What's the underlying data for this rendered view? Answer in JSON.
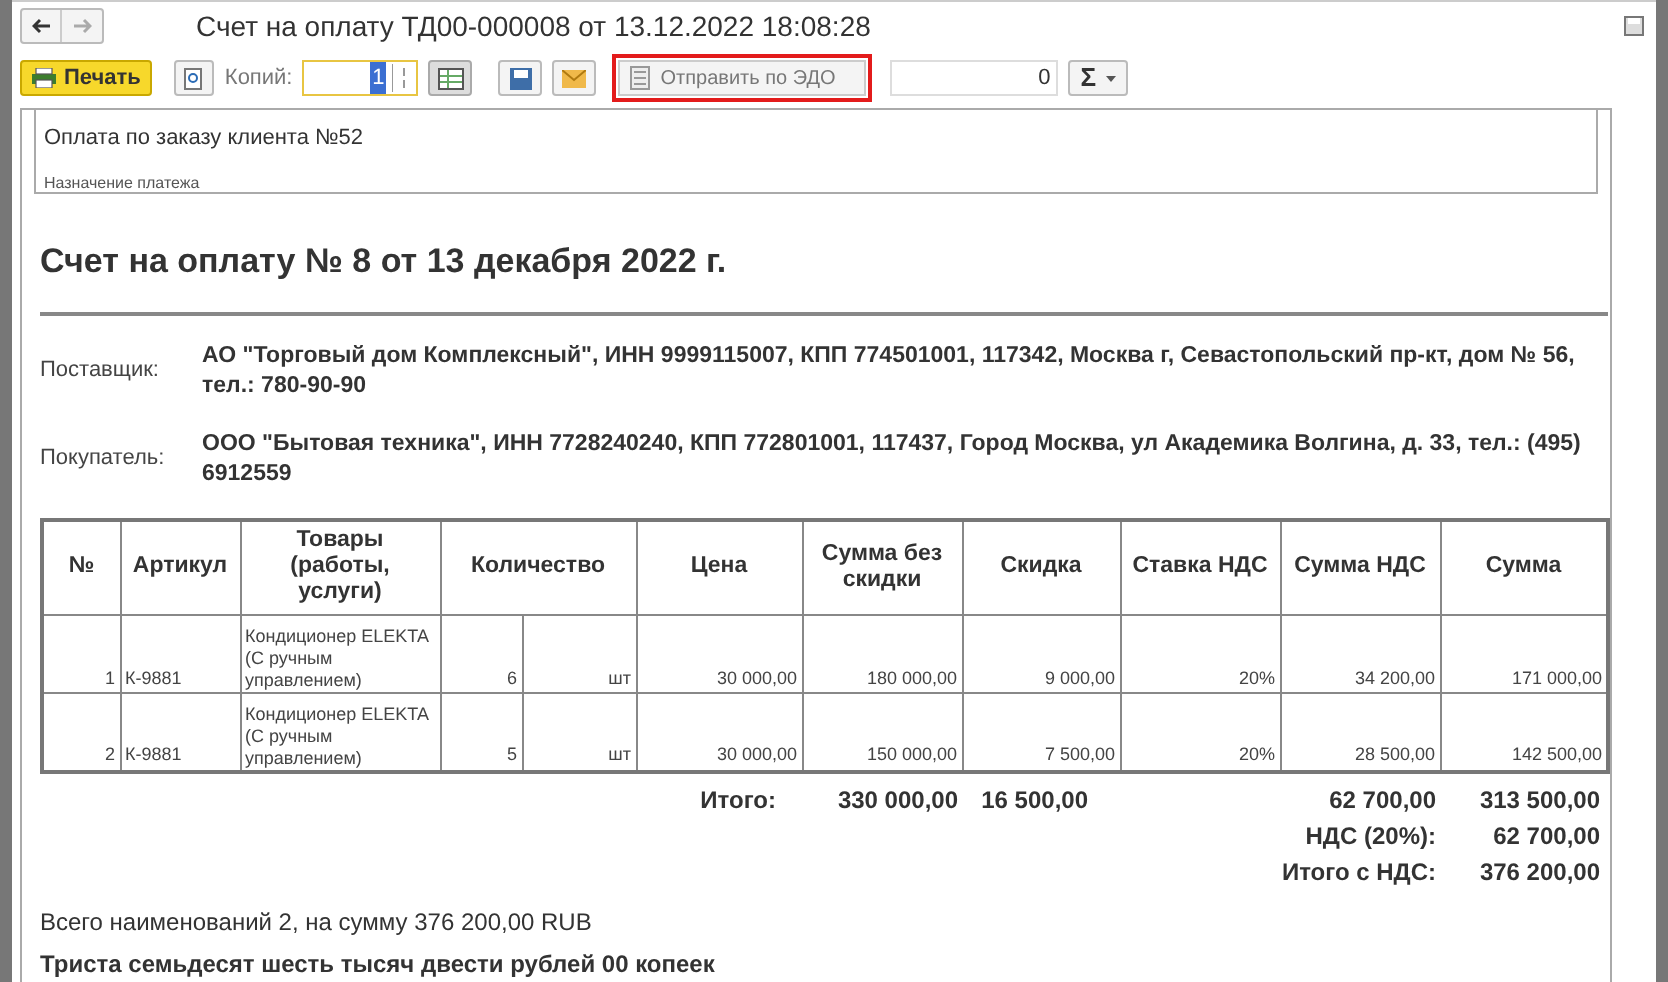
{
  "window": {
    "title": "Счет на оплату ТД00-000008 от 13.12.2022 18:08:28"
  },
  "toolbar": {
    "print": "Печать",
    "copies_label": "Копий:",
    "copies_value": "1",
    "send": "Отправить по ЭДО",
    "counter": "0",
    "sum_symbol": "Σ"
  },
  "note": {
    "value": "Оплата по заказу клиента №52",
    "label": "Назначение платежа"
  },
  "document": {
    "title": "Счет на оплату № 8 от 13 декабря 2022 г.",
    "parties": [
      {
        "label": "Поставщик:",
        "value": "АО \"Торговый дом Комплексный\", ИНН 9999115007, КПП 774501001, 117342, Москва г, Севастопольский пр-кт, дом № 56, тел.: 780-90-90"
      },
      {
        "label": "Покупатель:",
        "value": "ООО \"Бытовая техника\", ИНН 7728240240, КПП 772801001, 117437, Город Москва, ул Академика Волгина, д. 33, тел.: (495) 6912559"
      }
    ],
    "table": {
      "columns": [
        "№",
        "Артикул",
        "Товары (работы, услуги)",
        "Количество",
        "Цена",
        "Сумма без скидки",
        "Скидка",
        "Ставка НДС",
        "Сумма НДС",
        "Сумма"
      ],
      "rows": [
        {
          "num": "1",
          "article": "К-9881",
          "goods": "Кондиционер ELEKTA (С ручным управлением)",
          "qty": "6",
          "unit": "шт",
          "price": "30 000,00",
          "sum_no_discount": "180 000,00",
          "discount": "9 000,00",
          "vat_rate": "20%",
          "vat_sum": "34 200,00",
          "sum": "171 000,00"
        },
        {
          "num": "2",
          "article": "К-9881",
          "goods": "Кондиционер ELEKTA (С ручным управлением)",
          "qty": "5",
          "unit": "шт",
          "price": "30 000,00",
          "sum_no_discount": "150 000,00",
          "discount": "7 500,00",
          "vat_rate": "20%",
          "vat_sum": "28 500,00",
          "sum": "142 500,00"
        }
      ]
    },
    "totals": {
      "label": "Итого:",
      "sum_no_discount": "330 000,00",
      "discount": "16 500,00",
      "vat_sum": "62 700,00",
      "sum": "313 500,00"
    },
    "extra_totals": [
      {
        "label": "НДС (20%):",
        "value": "62 700,00"
      },
      {
        "label": "Итого с НДС:",
        "value": "376 200,00"
      }
    ],
    "summary": "Всего наименований 2, на сумму 376 200,00 RUB",
    "in_words": "Триста семьдесят шесть тысяч двести рублей 00 копеек"
  }
}
